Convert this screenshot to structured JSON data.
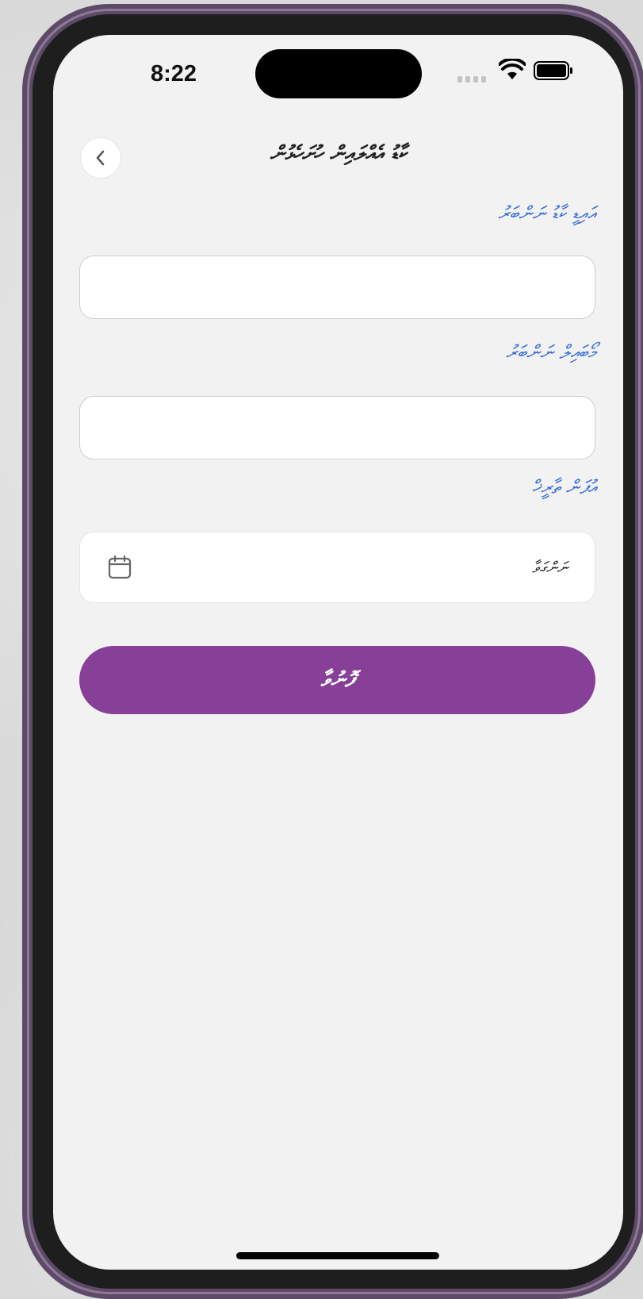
{
  "status_bar": {
    "time": "8:22",
    "signal_icon": "cellular-signal-icon",
    "wifi_icon": "wifi-icon",
    "battery_icon": "battery-full-icon"
  },
  "header": {
    "back_icon": "chevron-left-icon",
    "title": "ކާޑު އެއްލައިން ހުށަހެޅުން"
  },
  "form": {
    "id_card_label": "އައިޑީ ކާޑު ނަންބަރު",
    "id_card_value": "",
    "mobile_label": "މޯބައިލް ނަންބަރު",
    "mobile_value": "",
    "dob_label": "އުފަން ތާރީޚް",
    "dob_placeholder": "ނަންގަވާ",
    "calendar_icon": "calendar-icon",
    "submit_label": "ފޮނުވާ"
  },
  "colors": {
    "accent": "#873f98",
    "label": "#3b6fd8",
    "frame": "#5e4a68",
    "background": "#f2f2f2"
  }
}
